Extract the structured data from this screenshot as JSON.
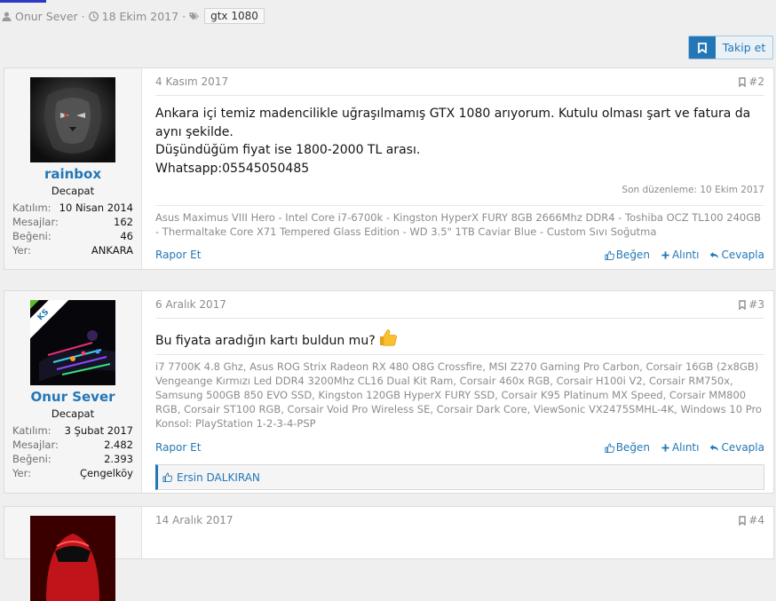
{
  "thread_meta": {
    "author": "Onur Sever",
    "date": "18 Ekim 2017",
    "tag": "gtx 1080"
  },
  "follow": {
    "label": "Takip et"
  },
  "colors": {
    "accent": "#2377b6",
    "link": "#2377b6",
    "muted": "#8c8c8c"
  },
  "posts": [
    {
      "date": "4 Kasım 2017",
      "number": "#2",
      "user": {
        "name": "rainbox",
        "title": "Decapat",
        "stats": [
          {
            "label": "Katılım:",
            "value": "10 Nisan 2014"
          },
          {
            "label": "Mesajlar:",
            "value": "162"
          },
          {
            "label": "Beğeni:",
            "value": "46"
          },
          {
            "label": "Yer:",
            "value": "ANKARA"
          }
        ]
      },
      "body": [
        "Ankara içi temiz madencilikle uğraşılmamış GTX 1080 arıyorum. Kutulu olması şart ve fatura da aynı şekilde.",
        "Düşündüğüm fiyat ise 1800-2000 TL arası.",
        "Whatsapp:05545050485"
      ],
      "edited": "Son düzenleme: 10 Ekim 2017",
      "signature": "Asus Maximus VIII Hero - Intel Core i7-6700k - Kingston HyperX FURY 8GB 2666Mhz DDR4 - Toshiba OCZ TL100 240GB - Thermaltake Core X71 Tempered Glass Edition - WD 3.5\" 1TB Caviar Blue - Custom Sıvı Soğutma",
      "actions": {
        "report": "Rapor Et",
        "like": "Beğen",
        "quote": "Alıntı",
        "reply": "Cevapla"
      }
    },
    {
      "date": "6 Aralık 2017",
      "number": "#3",
      "user": {
        "name": "Onur Sever",
        "title": "Decapat",
        "badge": "KS",
        "stats": [
          {
            "label": "Katılım:",
            "value": "3 Şubat 2017"
          },
          {
            "label": "Mesajlar:",
            "value": "2.482"
          },
          {
            "label": "Beğeni:",
            "value": "2.393"
          },
          {
            "label": "Yer:",
            "value": "Çengelköy"
          }
        ]
      },
      "body": [
        "Bu fiyata aradığın kartı buldun mu?"
      ],
      "signature_lines": [
        "i7 7700K 4.8 Ghz, Asus ROG Strix Radeon RX 480 O8G Crossfire, MSI Z270 Gaming Pro Carbon, Corsair 16GB (2x8GB) Vengeange Kırmızı Led DDR4 3200Mhz CL16 Dual Kit Ram, Corsair 460x RGB, Corsair H100i V2, Corsair RM750x, Samsung 500GB 850 EVO SSD, Kingston 120GB HyperX FURY SSD, Corsair K95 Platinum MX Speed, Corsair MM800 RGB, Corsair ST100 RGB, Corsair Void Pro Wireless SE, Corsair Dark Core, ViewSonic VX2475SMHL-4K, Windows 10 Pro",
        "Konsol: PlayStation 1-2-3-4-PSP"
      ],
      "likes": "Ersin DALKIRAN",
      "actions": {
        "report": "Rapor Et",
        "like": "Beğen",
        "quote": "Alıntı",
        "reply": "Cevapla"
      }
    },
    {
      "date": "14 Aralık 2017",
      "number": "#4"
    }
  ]
}
